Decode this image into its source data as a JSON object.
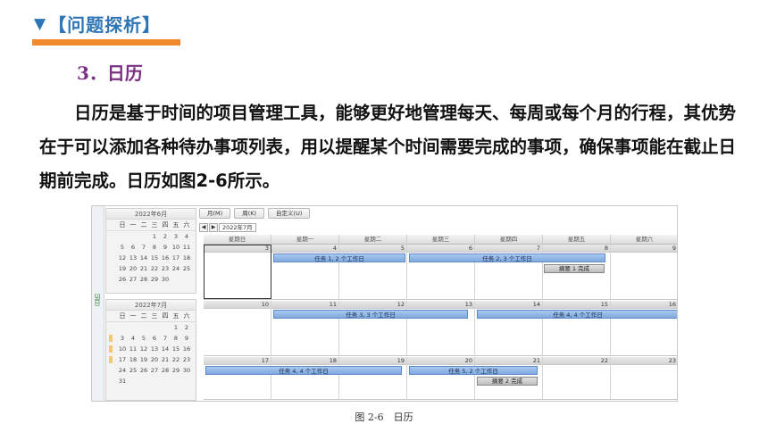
{
  "header": {
    "marker": "▼",
    "title": "【问题探析】",
    "accent_color": "#2e75b6",
    "underline_color": "#f08a2c"
  },
  "section": {
    "number": "3．",
    "title": "日历",
    "color": "#7b2e83"
  },
  "paragraph": "日历是基于时间的项目管理工具，能够更好地管理每天、每周或每个月的行程，其优势在于可以添加各种待办事项列表，用以提醒某个时间需要完成的事项，确保事项能在截止日期前完成。日历如图2-6所示。",
  "figure": {
    "side_label": "日历",
    "mini_calendars": [
      {
        "title": "2022年6月",
        "weekdays": [
          "日",
          "一",
          "二",
          "三",
          "四",
          "五",
          "六"
        ],
        "days": [
          "",
          "",
          "",
          "1",
          "2",
          "3",
          "4",
          "5",
          "6",
          "7",
          "8",
          "9",
          "10",
          "11",
          "12",
          "13",
          "14",
          "15",
          "16",
          "17",
          "18",
          "19",
          "20",
          "21",
          "22",
          "23",
          "24",
          "25",
          "26",
          "27",
          "28",
          "29",
          "30",
          "",
          "",
          "",
          "",
          ""
        ]
      },
      {
        "title": "2022年7月",
        "weekdays": [
          "日",
          "一",
          "二",
          "三",
          "四",
          "五",
          "六"
        ],
        "days": [
          "",
          "",
          "",
          "",
          "",
          "1",
          "2",
          "3",
          "4",
          "5",
          "6",
          "7",
          "8",
          "9",
          "10",
          "11",
          "12",
          "13",
          "14",
          "15",
          "16",
          "17",
          "18",
          "19",
          "20",
          "21",
          "22",
          "23",
          "24",
          "25",
          "26",
          "27",
          "28",
          "29",
          "30",
          "31",
          "",
          "",
          "",
          "",
          "",
          ""
        ]
      }
    ],
    "tabs": [
      "月(M)",
      "周(K)",
      "自定义(U)"
    ],
    "nav": {
      "prev": "◀",
      "next": "▶",
      "label": "2022年7月"
    },
    "weekday_headers": [
      "星期日",
      "星期一",
      "星期二",
      "星期三",
      "星期四",
      "星期五",
      "星期六"
    ],
    "weeks": [
      {
        "days": [
          "3",
          "4",
          "5",
          "6",
          "7",
          "8",
          "9"
        ]
      },
      {
        "days": [
          "10",
          "11",
          "12",
          "13",
          "14",
          "15",
          "16"
        ]
      },
      {
        "days": [
          "17",
          "18",
          "19",
          "20",
          "21",
          "22",
          "23"
        ]
      }
    ],
    "events": {
      "e1": "任务 1, 2 个工作日",
      "e2": "任务 2, 3 个工作日",
      "s1": "摘要 1 完成",
      "e3": "任务 3, 3 个工作日",
      "e4": "任务 4, 4 个工作日",
      "e5": "任务 4, 4 个工作日",
      "e6": "任务 5, 2 个工作日",
      "s2": "摘要 2 完成"
    },
    "caption": "图 2-6　日历"
  }
}
